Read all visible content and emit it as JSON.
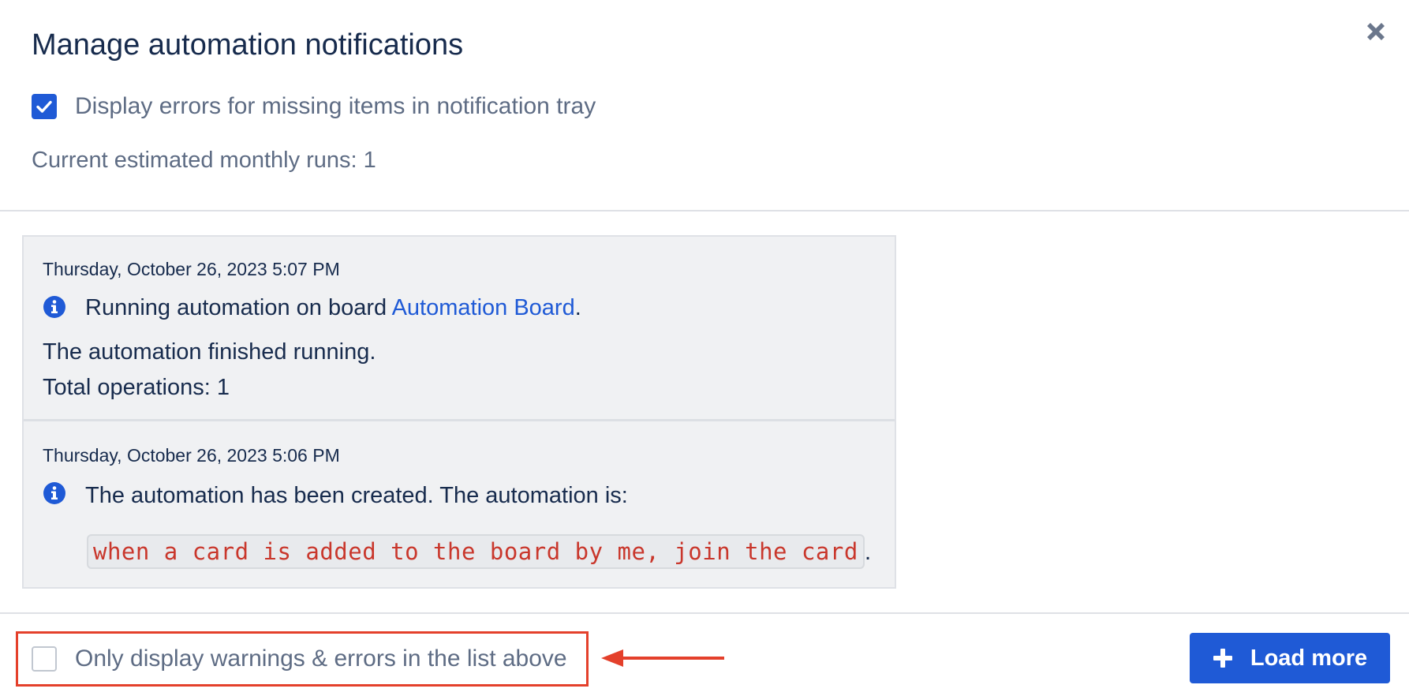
{
  "dialog": {
    "title": "Manage automation notifications",
    "close_icon": "close-icon"
  },
  "settings": {
    "display_errors_checked": true,
    "display_errors_label": "Display errors for missing items in notification tray",
    "monthly_runs_text": "Current estimated monthly runs: 1"
  },
  "log": {
    "entries": [
      {
        "date": "Thursday, October 26, 2023 5:07 PM",
        "icon": "info-icon",
        "message_prefix": "Running automation on board ",
        "board_link": "Automation Board",
        "message_suffix": ".",
        "line1": "The automation finished running.",
        "line2": "Total operations: 1"
      },
      {
        "date": "Thursday, October 26, 2023 5:06 PM",
        "icon": "info-icon",
        "message": "The automation has been created. The automation is:",
        "code": "when a card is added to the board by me, join the card",
        "code_suffix": "."
      }
    ]
  },
  "footer": {
    "filter_checked": false,
    "filter_label": "Only display warnings & errors in the list above",
    "load_more_label": "Load more",
    "load_more_icon": "plus-icon"
  },
  "colors": {
    "accent": "#1f5ad6",
    "highlight": "#e4402b",
    "code_text": "#c9372c"
  }
}
